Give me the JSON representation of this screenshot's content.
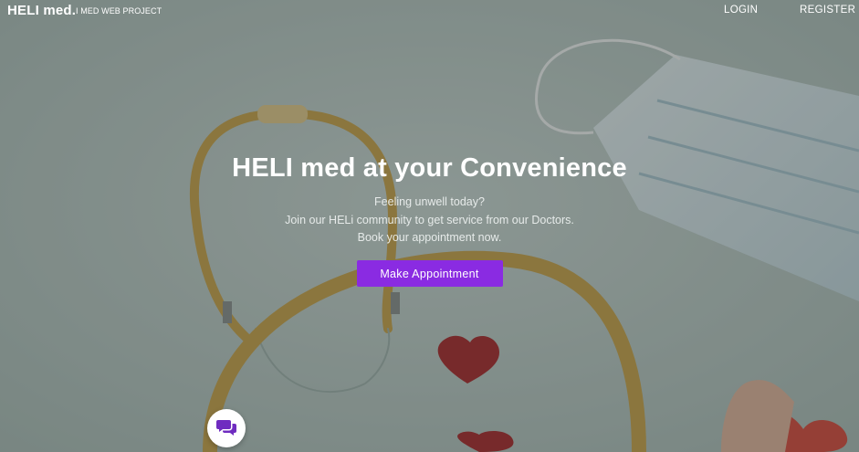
{
  "nav": {
    "brand": "HELI med.",
    "brand_subtitle": "I MED WEB PROJECT",
    "login": "LOGIN",
    "register": "REGISTER"
  },
  "hero": {
    "title": "HELI med at your Convenience",
    "lines": [
      "Feeling unwell today?",
      "Join our HELi community to get service from our Doctors.",
      "Book your appointment now."
    ],
    "cta_label": "Make Appointment",
    "background_subject": "stethoscope, face mask and red heart candies on pale background"
  },
  "chat_widget": {
    "icon": "chat-bubbles-icon"
  },
  "colors": {
    "accent": "#8a2be2",
    "text": "#ffffff"
  }
}
